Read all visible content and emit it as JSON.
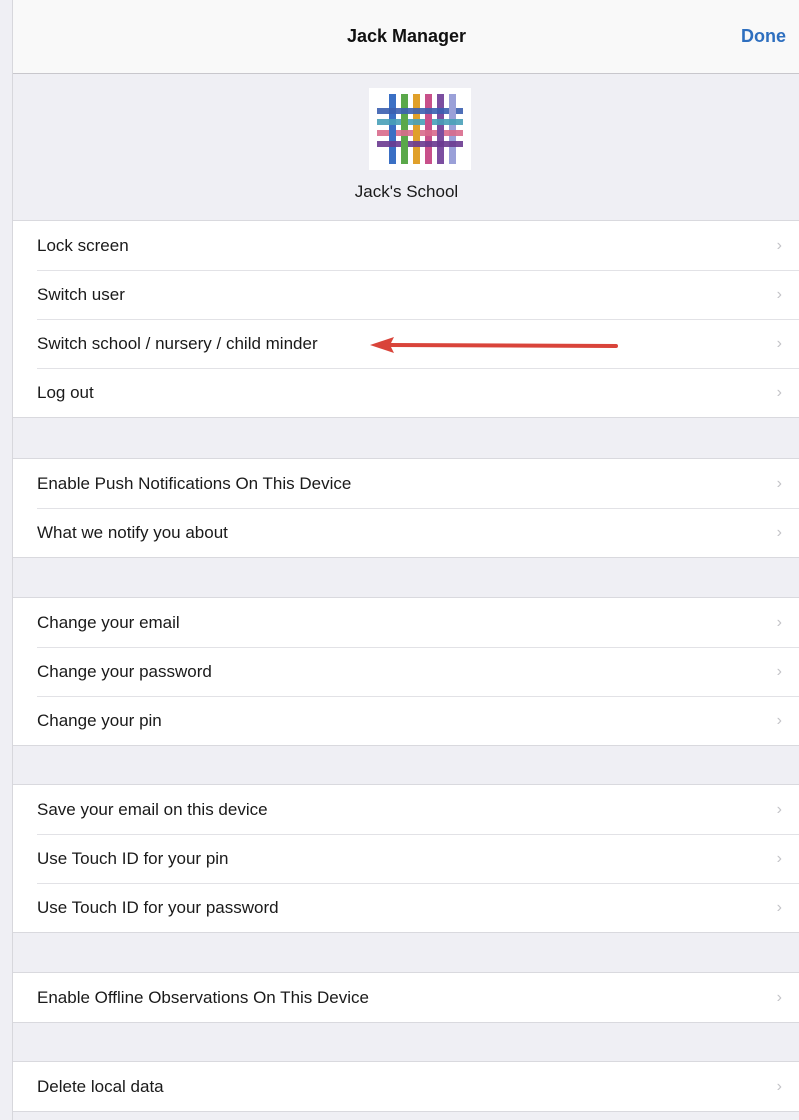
{
  "navbar": {
    "title": "Jack Manager",
    "done_label": "Done"
  },
  "header": {
    "school_name": "Jack's School",
    "logo_icon": "school-logo-icon"
  },
  "sections": [
    {
      "items": [
        "Lock screen",
        "Switch user",
        "Switch school / nursery / child minder",
        "Log out"
      ]
    },
    {
      "items": [
        "Enable Push Notifications On This Device",
        "What we notify you about"
      ]
    },
    {
      "items": [
        "Change your email",
        "Change your password",
        "Change your pin"
      ]
    },
    {
      "items": [
        "Save your email on this device",
        "Use Touch ID for your pin",
        "Use Touch ID for your password"
      ]
    },
    {
      "items": [
        "Enable Offline Observations On This Device"
      ]
    },
    {
      "items": [
        "Delete local data"
      ]
    }
  ],
  "chevron_glyph": "›",
  "colors": {
    "accent": "#2e6fbf",
    "annotation_arrow": "#d9443a",
    "background": "#efeff4"
  }
}
